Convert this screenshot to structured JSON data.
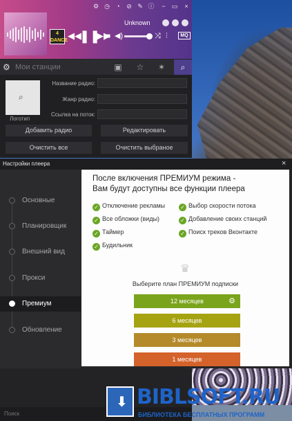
{
  "player": {
    "track_title": "Unknown",
    "stations_placeholder": "Мои станции",
    "quality_badge": "MQ",
    "cover_logo_text": "4 DANCE"
  },
  "form": {
    "logo_label": "Логотип",
    "name_label": "Название радио:",
    "genre_label": "Жанр радио:",
    "stream_label": "Ссылка на поток:",
    "add_button": "Добавить радио",
    "edit_button": "Редактировать",
    "clear_all_button": "Очистить все",
    "clear_selected_button": "Очистить выбраное"
  },
  "settings": {
    "title": "Настройки плеера",
    "close": "×",
    "nav": [
      {
        "label": "Основные",
        "active": false
      },
      {
        "label": "Планировщик",
        "active": false
      },
      {
        "label": "Внешний вид",
        "active": false
      },
      {
        "label": "Прокси",
        "active": false
      },
      {
        "label": "Премиум",
        "active": true
      },
      {
        "label": "Обновление",
        "active": false
      }
    ],
    "premium": {
      "heading_line1": "После включения ПРЕМИУМ режима -",
      "heading_line2": "Вам будут доступны все функции плеера",
      "features_left": [
        "Отключение рекламы",
        "Все обложки (виды)",
        "Таймер",
        "Будильник"
      ],
      "features_right": [
        "Выбор скорости потока",
        "Добавление своих станций",
        "Поиск треков Вконтакте"
      ],
      "plan_title": "Выберите план ПРЕМИУМ подписки",
      "plans": [
        {
          "label": "12 месяцев",
          "color": "#7aa41c"
        },
        {
          "label": "6 месяцев",
          "color": "#a6a313"
        },
        {
          "label": "3 месяцев",
          "color": "#b48a2a"
        },
        {
          "label": "1 месяцев",
          "color": "#d4622b"
        }
      ]
    }
  },
  "bottom": {
    "search_placeholder": "Поиск"
  },
  "watermark": {
    "title": "BIBLSOFT.RU",
    "subtitle": "БИБЛИОТЕКА БЕСПЛАТНЫХ ПРОГРАММ"
  }
}
